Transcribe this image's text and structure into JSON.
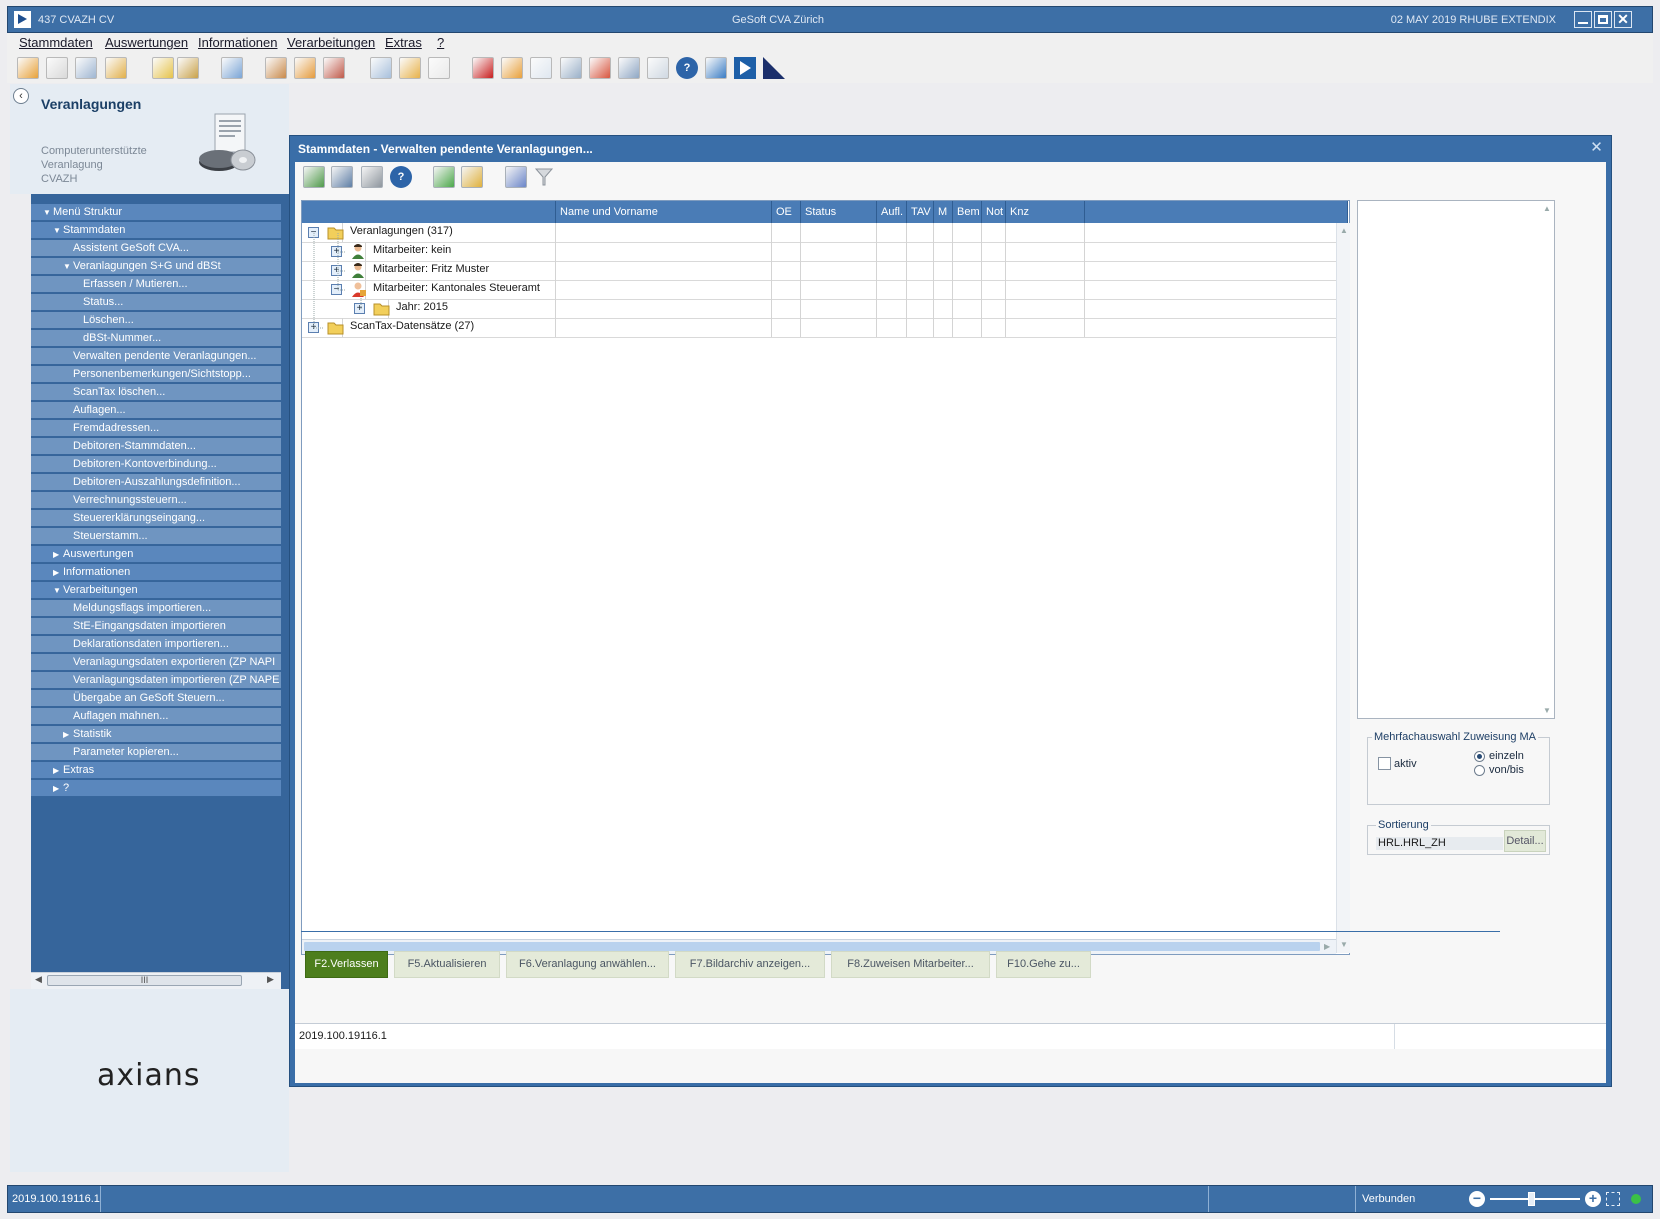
{
  "window": {
    "left_title": "437  CVAZH  CV",
    "center_title": "GeSoft CVA Zürich",
    "right_info": "02 MAY 2019  RHUBE  EXTENDIX",
    "close_glyph": "✕"
  },
  "menu": [
    "Stammdaten",
    "Auswertungen",
    "Informationen",
    "Verarbeitungen",
    "Extras",
    "?"
  ],
  "toolbar_icons": [
    "new-assessment-icon",
    "edit-assessment-icon",
    "assessment-status-icon",
    "assessment-note-icon",
    "magic-wand-icon",
    "search-persons-icon",
    "transfer-icon",
    "person-search-icon",
    "persons-icon",
    "persons-list-icon",
    "export-icon",
    "import-icon",
    "document-icon",
    "red-book-icon",
    "package-icon",
    "checklist-icon",
    "calculator-icon",
    "calendar-icon",
    "print-network-icon",
    "preview-icon",
    "help-icon",
    "refresh-icon",
    "blue-flag-icon",
    "navy-flag-icon"
  ],
  "sidebar": {
    "title": "Veranlagungen",
    "subtitle": [
      "Computerunterstützte",
      "Veranlagung",
      "CVAZH"
    ],
    "brand": "axians",
    "scroll_thumb": "III",
    "nav": [
      {
        "label": "Menü Struktur",
        "level": 0,
        "state": "expanded"
      },
      {
        "label": "Stammdaten",
        "level": 1,
        "state": "expanded"
      },
      {
        "label": "Assistent GeSoft CVA...",
        "level": 2,
        "state": "leaf"
      },
      {
        "label": "Veranlagungen S+G und dBSt",
        "level": 2,
        "state": "expanded"
      },
      {
        "label": "Erfassen / Mutieren...",
        "level": 3,
        "state": "leaf"
      },
      {
        "label": "Status...",
        "level": 3,
        "state": "leaf"
      },
      {
        "label": "Löschen...",
        "level": 3,
        "state": "leaf"
      },
      {
        "label": "dBSt-Nummer...",
        "level": 3,
        "state": "leaf"
      },
      {
        "label": "Verwalten pendente Veranlagungen...",
        "level": 2,
        "state": "leaf"
      },
      {
        "label": "Personenbemerkungen/Sichtstopp...",
        "level": 2,
        "state": "leaf"
      },
      {
        "label": "ScanTax löschen...",
        "level": 2,
        "state": "leaf"
      },
      {
        "label": "Auflagen...",
        "level": 2,
        "state": "leaf"
      },
      {
        "label": "Fremdadressen...",
        "level": 2,
        "state": "leaf"
      },
      {
        "label": "Debitoren-Stammdaten...",
        "level": 2,
        "state": "leaf"
      },
      {
        "label": "Debitoren-Kontoverbindung...",
        "level": 2,
        "state": "leaf"
      },
      {
        "label": "Debitoren-Auszahlungsdefinition...",
        "level": 2,
        "state": "leaf"
      },
      {
        "label": "Verrechnungssteuern...",
        "level": 2,
        "state": "leaf"
      },
      {
        "label": "Steuererklärungseingang...",
        "level": 2,
        "state": "leaf"
      },
      {
        "label": "Steuerstamm...",
        "level": 2,
        "state": "leaf"
      },
      {
        "label": "Auswertungen",
        "level": 1,
        "state": "collapsed"
      },
      {
        "label": "Informationen",
        "level": 1,
        "state": "collapsed"
      },
      {
        "label": "Verarbeitungen",
        "level": 1,
        "state": "expanded"
      },
      {
        "label": "Meldungsflags importieren...",
        "level": 2,
        "state": "leaf"
      },
      {
        "label": "StE-Eingangsdaten importieren",
        "level": 2,
        "state": "leaf"
      },
      {
        "label": "Deklarationsdaten importieren...",
        "level": 2,
        "state": "leaf"
      },
      {
        "label": "Veranlagungsdaten exportieren (ZP NAPI",
        "level": 2,
        "state": "leaf"
      },
      {
        "label": "Veranlagungsdaten importieren (ZP NAPE",
        "level": 2,
        "state": "leaf"
      },
      {
        "label": "Übergabe an GeSoft Steuern...",
        "level": 2,
        "state": "leaf"
      },
      {
        "label": "Auflagen mahnen...",
        "level": 2,
        "state": "leaf"
      },
      {
        "label": "Statistik",
        "level": 2,
        "state": "collapsed"
      },
      {
        "label": "Parameter kopieren...",
        "level": 2,
        "state": "leaf"
      },
      {
        "label": "Extras",
        "level": 1,
        "state": "collapsed"
      },
      {
        "label": "?",
        "level": 1,
        "state": "collapsed"
      }
    ]
  },
  "dialog": {
    "title": "Stammdaten - Verwalten pendente Veranlagungen...",
    "toolbar_icons": [
      "export-grid-icon",
      "print-setup-icon",
      "print-icon",
      "help-icon",
      "assign-icon",
      "wand-icon",
      "refresh-icon",
      "filter-icon"
    ],
    "columns": [
      "",
      "Name und Vorname",
      "OE",
      "Status",
      "Aufl.",
      "TAV",
      "M",
      "Bem",
      "Not",
      "Knz",
      ""
    ],
    "tree": [
      {
        "label": "Veranlagungen (317)",
        "level": 0,
        "toggle": "−",
        "icon": "open-folder-icon"
      },
      {
        "label": "Mitarbeiter: kein",
        "level": 1,
        "toggle": "+",
        "icon": "person-icon"
      },
      {
        "label": "Mitarbeiter: Fritz Muster",
        "level": 1,
        "toggle": "+",
        "icon": "person-icon"
      },
      {
        "label": "Mitarbeiter: Kantonales Steueramt",
        "level": 1,
        "toggle": "−",
        "icon": "office-person-icon"
      },
      {
        "label": "Jahr: 2015",
        "level": 2,
        "toggle": "+",
        "icon": "folder-icon"
      },
      {
        "label": "ScanTax-Datensätze (27)",
        "level": 0,
        "toggle": "+",
        "icon": "folder-icon"
      }
    ],
    "multi": {
      "legend": "Mehrfachauswahl Zuweisung MA",
      "aktiv_label": "aktiv",
      "aktiv_checked": false,
      "radio_options": [
        "einzeln",
        "von/bis"
      ],
      "radio_selected": "einzeln"
    },
    "sort": {
      "legend": "Sortierung",
      "value": "HRL.HRL_ZH",
      "detail_label": "Detail..."
    },
    "buttons": [
      {
        "key": "f2",
        "label": "F2.Verlassen"
      },
      {
        "key": "f5",
        "label": "F5.Aktualisieren"
      },
      {
        "key": "f6",
        "label": "F6.Veranlagung anwählen..."
      },
      {
        "key": "f7",
        "label": "F7.Bildarchiv anzeigen..."
      },
      {
        "key": "f8",
        "label": "F8.Zuweisen Mitarbeiter..."
      },
      {
        "key": "f10",
        "label": "F10.Gehe zu..."
      }
    ],
    "version": "2019.100.19116.1"
  },
  "statusbar": {
    "version": "2019.100.19116.1",
    "connection": "Verbunden",
    "zoom_minus": "−",
    "zoom_plus": "+"
  }
}
